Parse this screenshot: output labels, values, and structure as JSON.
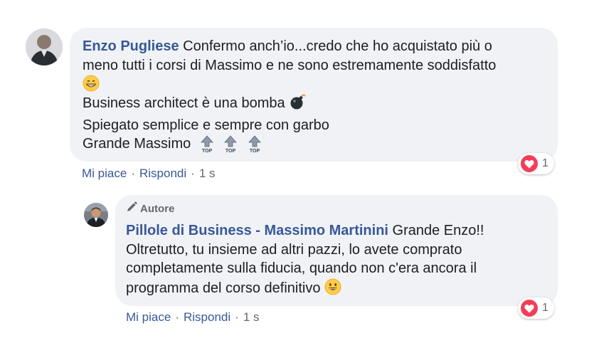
{
  "comment": {
    "author": "Enzo Pugliese",
    "text_line1": " Confermo anch’io...credo che ho acquistato più o",
    "text_line2": "meno tutti i corsi di Massimo e ne sono estremamente soddisfatto",
    "text_line3": "Business architect è una bomba",
    "text_line4": "Spiegato semplice e sempre con garbo",
    "text_line5": "Grande Massimo",
    "like_label": "Mi piace",
    "reply_label": "Rispondi",
    "time": "1 s",
    "reaction_count": "1"
  },
  "reply": {
    "badge_label": "Autore",
    "author": "Pillole di Business - Massimo Martinini",
    "text_line1": " Grande Enzo!!",
    "text_line2": "Oltretutto, tu insieme ad altri pazzi, lo avete comprato",
    "text_line3": "completamente sulla fiducia, quando non c'era ancora il",
    "text_line4": "programma del corso definitivo",
    "like_label": "Mi piace",
    "reply_label": "Rispondi",
    "time": "1 s",
    "reaction_count": "1"
  },
  "colors": {
    "author": "#385898",
    "bubble": "#f0f2f5",
    "heart": "#f33e58"
  },
  "icons": [
    "grinning-emoji-icon",
    "bomb-emoji-icon",
    "top-arrow-icon",
    "pencil-icon",
    "heart-reaction-icon",
    "smiling-emoji-icon"
  ]
}
